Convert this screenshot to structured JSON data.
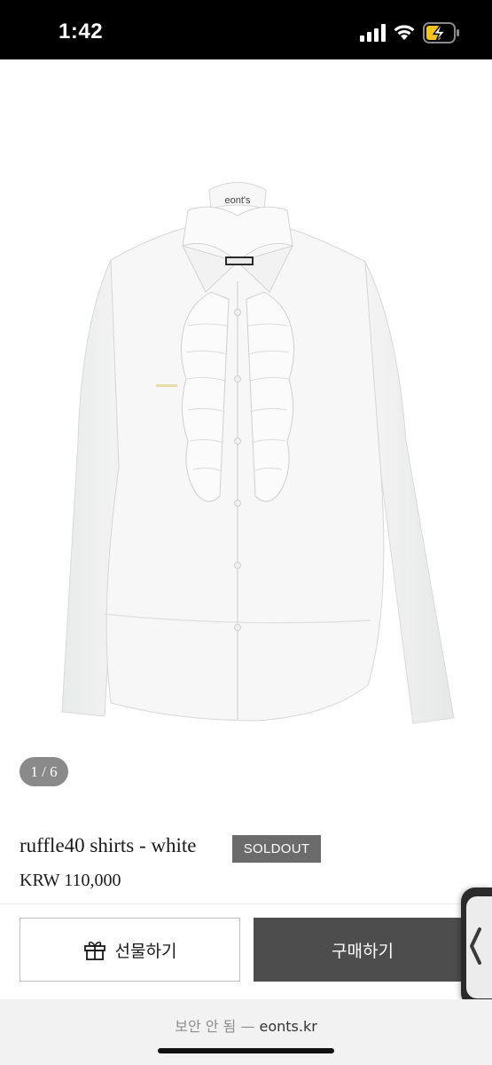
{
  "status_bar": {
    "time": "1:42",
    "icons": [
      "signal-icon",
      "wifi-icon",
      "battery-charging-icon"
    ],
    "battery_color": "#f5c31c"
  },
  "product": {
    "image_label": "eont's",
    "image_counter": "1 / 6",
    "name": "ruffle40 shirts - white",
    "badge": "SOLDOUT",
    "price": "KRW 110,000"
  },
  "actions": {
    "gift_label": "선물하기",
    "gift_icon": "gift-icon",
    "buy_label": "구매하기"
  },
  "browser": {
    "security_label": "보안 안 됨",
    "separator": "—",
    "domain": "eonts.kr"
  },
  "colors": {
    "badge_bg": "#6b6b6b",
    "buy_bg": "#4d4d4d",
    "indicator_bg": "#8a8a8a"
  }
}
